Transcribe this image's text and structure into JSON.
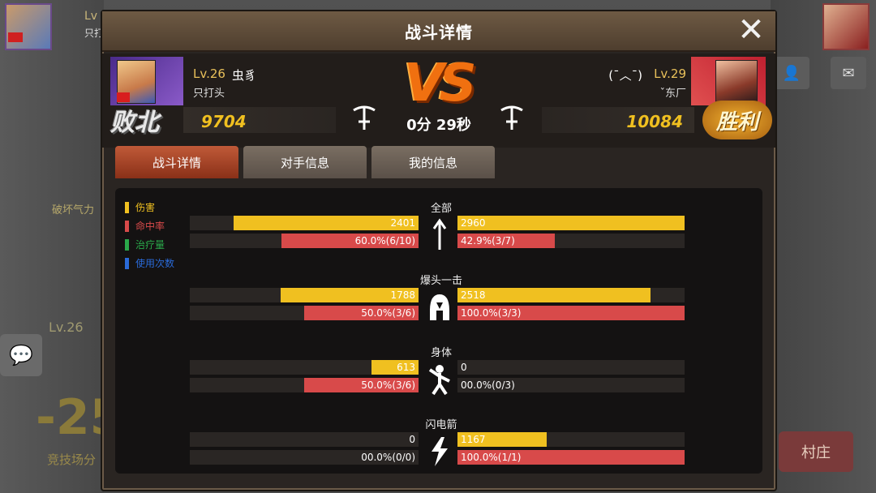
{
  "background": {
    "top_left_level": "Lv",
    "top_left_sub": "只打",
    "side_text": "破坏气力",
    "level_tag": "Lv.26",
    "big_number": "-25",
    "arena_label": "竞技场分",
    "village_button": "村庄"
  },
  "window": {
    "title": "战斗详情",
    "close_icon": "close-icon"
  },
  "player_left": {
    "level": "Lv.26",
    "name": "虫豸",
    "guild": "只打头",
    "score": "9704",
    "result": "败北"
  },
  "player_right": {
    "level": "Lv.29",
    "name": "(¯︿¯)",
    "guild": "ˇ东厂",
    "score": "10084",
    "result": "胜利"
  },
  "match": {
    "vs": "VS",
    "duration": "0分 29秒"
  },
  "tabs": [
    {
      "label": "战斗详情",
      "active": true
    },
    {
      "label": "对手信息",
      "active": false
    },
    {
      "label": "我的信息",
      "active": false
    }
  ],
  "legend": [
    {
      "label": "伤害",
      "color": "#f0c020"
    },
    {
      "label": "命中率",
      "color": "#d84a4a"
    },
    {
      "label": "治疗量",
      "color": "#2aa84a"
    },
    {
      "label": "使用次数",
      "color": "#2a6ad8"
    }
  ],
  "sections": [
    {
      "title": "全部",
      "icon": "arrow-icon",
      "damage": {
        "left": "2401",
        "right": "2960",
        "left_ratio": 0.81,
        "right_ratio": 1.0
      },
      "hit": {
        "left": "60.0%(6/10)",
        "right": "42.9%(3/7)",
        "left_ratio": 0.6,
        "right_ratio": 0.429
      }
    },
    {
      "title": "爆头一击",
      "icon": "helmet-icon",
      "damage": {
        "left": "1788",
        "right": "2518",
        "left_ratio": 0.604,
        "right_ratio": 0.851
      },
      "hit": {
        "left": "50.0%(3/6)",
        "right": "100.0%(3/3)",
        "left_ratio": 0.5,
        "right_ratio": 1.0
      }
    },
    {
      "title": "身体",
      "icon": "body-icon",
      "damage": {
        "left": "613",
        "right": "0",
        "left_ratio": 0.207,
        "right_ratio": 0
      },
      "hit": {
        "left": "50.0%(3/6)",
        "right": "00.0%(0/3)",
        "left_ratio": 0.5,
        "right_ratio": 0
      }
    },
    {
      "title": "闪电箭",
      "icon": "lightning-icon",
      "damage": {
        "left": "0",
        "right": "1167",
        "left_ratio": 0,
        "right_ratio": 0.394
      },
      "hit": {
        "left": "00.0%(0/0)",
        "right": "100.0%(1/1)",
        "left_ratio": 0,
        "right_ratio": 1.0
      }
    }
  ]
}
